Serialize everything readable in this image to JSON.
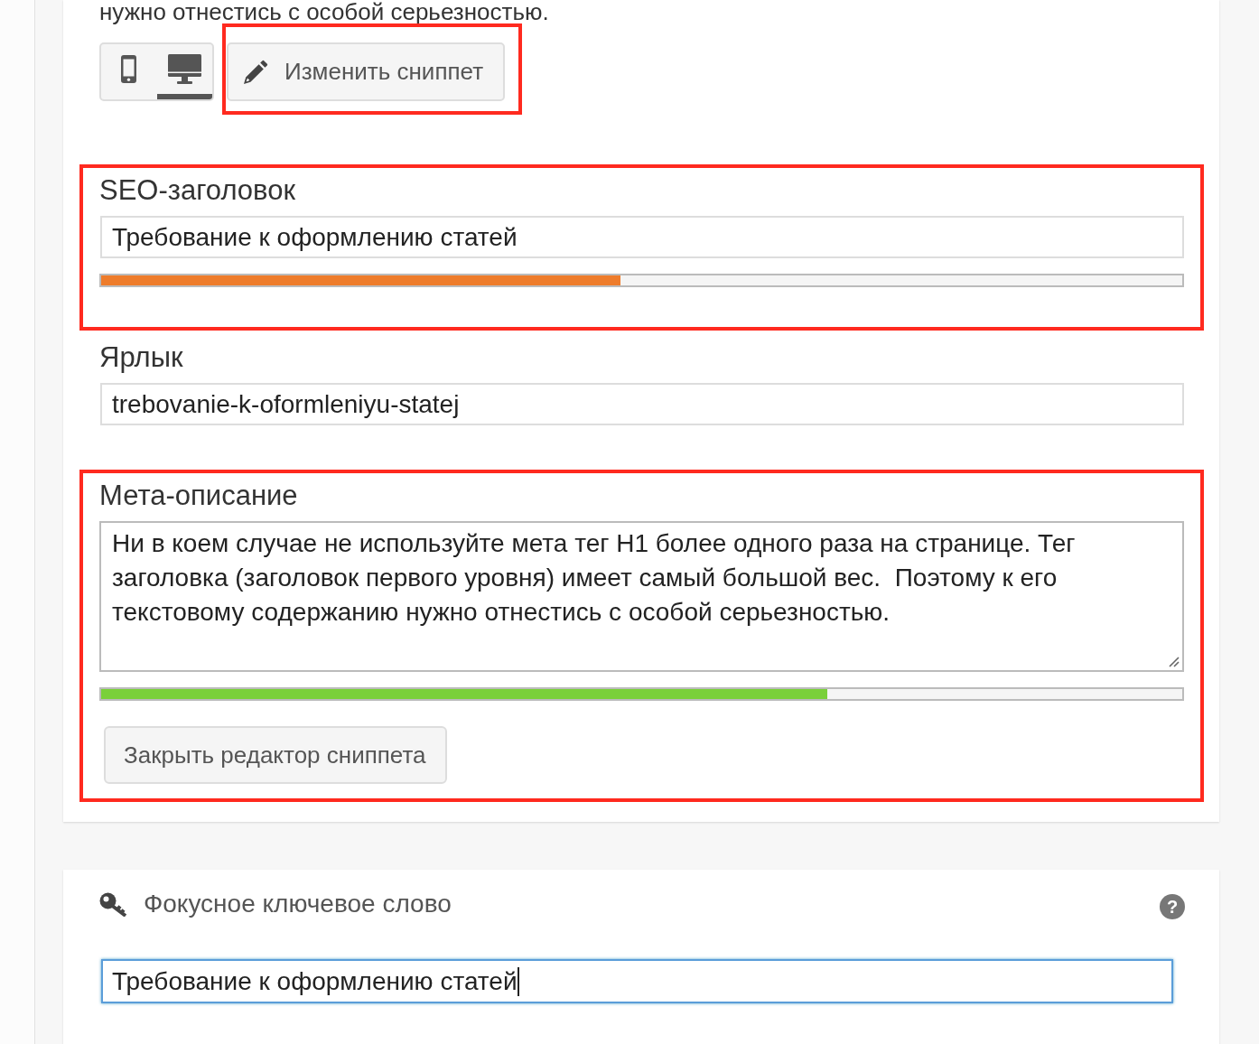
{
  "intro_text": "нужно отнестись с особой серьезностью.",
  "preview_modes": [
    {
      "kind": "mobile",
      "selected": false
    },
    {
      "kind": "desktop",
      "selected": true
    }
  ],
  "edit_snippet": {
    "label": "Изменить сниппет",
    "highlighted": true
  },
  "fields": [
    {
      "kind": "input",
      "highlighted": true,
      "label": "SEO-заголовок",
      "value": "Требование к оформлению статей",
      "progress": {
        "level": 0.48,
        "color": "#ee7c2b"
      }
    },
    {
      "kind": "input",
      "highlighted": false,
      "label": "Ярлык",
      "value": "trebovanie-k-oformleniyu-statej"
    },
    {
      "kind": "textarea",
      "highlighted": true,
      "label": "Мета-описание",
      "value": "Ни в коем случае не используйте мета тег H1 более одного раза на странице. Тег заголовка (заголовок первого уровня) имеет самый большой вес.  Поэтому к его текстовому содержанию нужно отнестись с особой серьезностью.",
      "progress": {
        "level": 0.672,
        "color": "#7ad03a"
      },
      "button": "Закрыть редактор сниппета"
    }
  ],
  "focus_keyword": {
    "title": "Фокусное ключевое слово",
    "help": "?",
    "value": "Требование к оформлению статей",
    "focused": true
  }
}
